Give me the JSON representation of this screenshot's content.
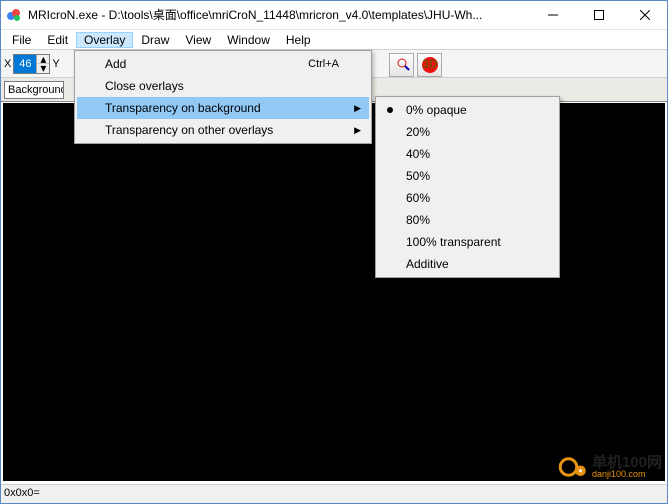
{
  "title": "MRIcroN.exe - D:\\tools\\桌面\\office\\mriCroN_11448\\mricron_v4.0\\templates\\JHU-Wh...",
  "menubar": [
    "File",
    "Edit",
    "Overlay",
    "Draw",
    "View",
    "Window",
    "Help"
  ],
  "open_menu_index": 2,
  "coords": {
    "x_label": "X",
    "x_value": "46",
    "y_label": "Y"
  },
  "combo": {
    "label": "Background"
  },
  "overlay_menu": {
    "items": [
      {
        "label": "Add",
        "shortcut": "Ctrl+A"
      },
      {
        "label": "Close overlays"
      },
      {
        "label": "Transparency on background",
        "submenu": true,
        "highlight": true
      },
      {
        "label": "Transparency on other overlays",
        "submenu": true
      }
    ]
  },
  "transparency_submenu": {
    "selected_index": 0,
    "items": [
      {
        "label": "0% opaque"
      },
      {
        "label": "20%"
      },
      {
        "label": "40%"
      },
      {
        "label": "50%"
      },
      {
        "label": "60%"
      },
      {
        "label": "80%"
      },
      {
        "label": "100% transparent"
      },
      {
        "label": "Additive"
      }
    ]
  },
  "status": "0x0x0=",
  "watermark": {
    "line1": "单机100网",
    "line2": "danji100.com"
  }
}
